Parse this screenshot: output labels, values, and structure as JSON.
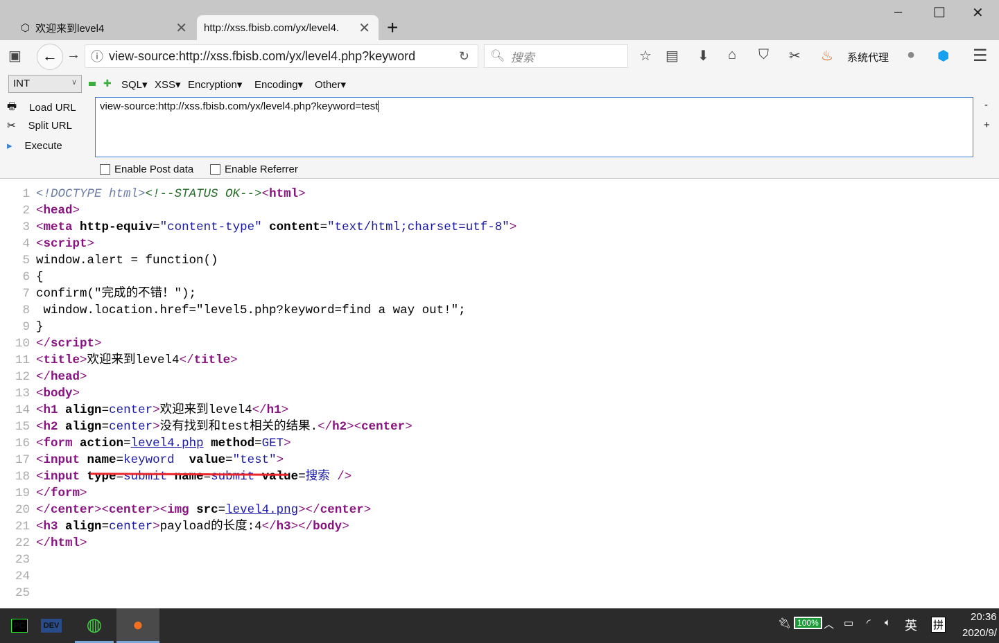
{
  "browser": {
    "tabs": [
      {
        "label": "欢迎来到level4",
        "active": false
      },
      {
        "label": "http://xss.fbisb.com/yx/level4.",
        "active": true
      }
    ],
    "new_tab": "+",
    "window_controls": {
      "minimize": "–",
      "maximize": "☐",
      "close": "✕"
    },
    "address": "view-source:http://xss.fbisb.com/yx/level4.php?keyword",
    "search_placeholder": "搜索",
    "proxy_label": "系统代理"
  },
  "hackbar": {
    "select_value": "INT",
    "menus": [
      "SQL▾",
      "XSS▾",
      "Encryption▾",
      "Encoding▾",
      "Other▾"
    ],
    "load_url": "Load URL",
    "split_url": "Split URL",
    "execute": "Execute",
    "url_value": "view-source:http://xss.fbisb.com/yx/level4.php?keyword=test",
    "minus": "-",
    "plus": "+",
    "enable_post": "Enable Post data",
    "enable_referrer": "Enable Referrer"
  },
  "source": {
    "lines": [
      [
        [
          "d",
          "<!DOCTYPE html>"
        ],
        [
          "c",
          "<!--STATUS OK-->"
        ],
        [
          "p",
          "<"
        ],
        [
          "t",
          "html"
        ],
        [
          "p",
          ">"
        ]
      ],
      [
        [
          "p",
          "<"
        ],
        [
          "t",
          "head"
        ],
        [
          "p",
          ">"
        ]
      ],
      [
        [
          "p",
          "<"
        ],
        [
          "t",
          "meta"
        ],
        [
          "x",
          " "
        ],
        [
          "a",
          "http-equiv"
        ],
        [
          "x",
          "="
        ],
        [
          "v",
          "\"content-type\""
        ],
        [
          "x",
          " "
        ],
        [
          "a",
          "content"
        ],
        [
          "x",
          "="
        ],
        [
          "v",
          "\"text/html;charset=utf-8\""
        ],
        [
          "p",
          ">"
        ]
      ],
      [
        [
          "p",
          "<"
        ],
        [
          "t",
          "script"
        ],
        [
          "p",
          ">"
        ]
      ],
      [
        [
          "x",
          "window.alert = function()"
        ]
      ],
      [
        [
          "x",
          "{"
        ]
      ],
      [
        [
          "x",
          "confirm(\"完成的不错！\");"
        ]
      ],
      [
        [
          "x",
          " window.location.href=\"level5.php?keyword=find a way out!\";"
        ]
      ],
      [
        [
          "x",
          "}"
        ]
      ],
      [
        [
          "p",
          "</"
        ],
        [
          "t",
          "script"
        ],
        [
          "p",
          ">"
        ]
      ],
      [
        [
          "p",
          "<"
        ],
        [
          "t",
          "title"
        ],
        [
          "p",
          ">"
        ],
        [
          "x",
          "欢迎来到level4"
        ],
        [
          "p",
          "</"
        ],
        [
          "t",
          "title"
        ],
        [
          "p",
          ">"
        ]
      ],
      [
        [
          "p",
          "</"
        ],
        [
          "t",
          "head"
        ],
        [
          "p",
          ">"
        ]
      ],
      [
        [
          "p",
          "<"
        ],
        [
          "t",
          "body"
        ],
        [
          "p",
          ">"
        ]
      ],
      [
        [
          "p",
          "<"
        ],
        [
          "t",
          "h1"
        ],
        [
          "x",
          " "
        ],
        [
          "a",
          "align"
        ],
        [
          "x",
          "="
        ],
        [
          "v",
          "center"
        ],
        [
          "p",
          ">"
        ],
        [
          "x",
          "欢迎来到level4"
        ],
        [
          "p",
          "</"
        ],
        [
          "t",
          "h1"
        ],
        [
          "p",
          ">"
        ]
      ],
      [
        [
          "p",
          "<"
        ],
        [
          "t",
          "h2"
        ],
        [
          "x",
          " "
        ],
        [
          "a",
          "align"
        ],
        [
          "x",
          "="
        ],
        [
          "v",
          "center"
        ],
        [
          "p",
          ">"
        ],
        [
          "x",
          "没有找到和test相关的结果."
        ],
        [
          "p",
          "</"
        ],
        [
          "t",
          "h2"
        ],
        [
          "p",
          "><"
        ],
        [
          "t",
          "center"
        ],
        [
          "p",
          ">"
        ]
      ],
      [
        [
          "p",
          "<"
        ],
        [
          "t",
          "form"
        ],
        [
          "x",
          " "
        ],
        [
          "a",
          "action"
        ],
        [
          "x",
          "="
        ],
        [
          "l",
          "level4.php"
        ],
        [
          "x",
          " "
        ],
        [
          "a",
          "method"
        ],
        [
          "x",
          "="
        ],
        [
          "v",
          "GET"
        ],
        [
          "p",
          ">"
        ]
      ],
      [
        [
          "p",
          "<"
        ],
        [
          "t",
          "input"
        ],
        [
          "x",
          " "
        ],
        [
          "a",
          "name"
        ],
        [
          "x",
          "="
        ],
        [
          "v",
          "keyword"
        ],
        [
          "x",
          "  "
        ],
        [
          "a",
          "value"
        ],
        [
          "x",
          "="
        ],
        [
          "v",
          "\"test\""
        ],
        [
          "p",
          ">"
        ]
      ],
      [
        [
          "p",
          "<"
        ],
        [
          "t",
          "input"
        ],
        [
          "x",
          " "
        ],
        [
          "a",
          "type"
        ],
        [
          "x",
          "="
        ],
        [
          "v",
          "submit"
        ],
        [
          "x",
          " "
        ],
        [
          "a",
          "name"
        ],
        [
          "x",
          "="
        ],
        [
          "v",
          "submit"
        ],
        [
          "x",
          " "
        ],
        [
          "a",
          "value"
        ],
        [
          "x",
          "="
        ],
        [
          "v",
          "搜索"
        ],
        [
          "x",
          " "
        ],
        [
          "p",
          "/>"
        ]
      ],
      [
        [
          "p",
          "</"
        ],
        [
          "t",
          "form"
        ],
        [
          "p",
          ">"
        ]
      ],
      [
        [
          "p",
          "</"
        ],
        [
          "t",
          "center"
        ],
        [
          "p",
          "><"
        ],
        [
          "t",
          "center"
        ],
        [
          "p",
          "><"
        ],
        [
          "t",
          "img"
        ],
        [
          "x",
          " "
        ],
        [
          "a",
          "src"
        ],
        [
          "x",
          "="
        ],
        [
          "l",
          "level4.png"
        ],
        [
          "p",
          "></"
        ],
        [
          "t",
          "center"
        ],
        [
          "p",
          ">"
        ]
      ],
      [
        [
          "p",
          "<"
        ],
        [
          "t",
          "h3"
        ],
        [
          "x",
          " "
        ],
        [
          "a",
          "align"
        ],
        [
          "x",
          "="
        ],
        [
          "v",
          "center"
        ],
        [
          "p",
          ">"
        ],
        [
          "x",
          "payload的长度:4"
        ],
        [
          "p",
          "</"
        ],
        [
          "t",
          "h3"
        ],
        [
          "p",
          "></"
        ],
        [
          "t",
          "body"
        ],
        [
          "p",
          ">"
        ]
      ],
      [
        [
          "p",
          "</"
        ],
        [
          "t",
          "html"
        ],
        [
          "p",
          ">"
        ]
      ],
      [],
      [],
      []
    ]
  },
  "taskbar": {
    "apps": [
      "PyCharm",
      "Dev-C++",
      "360 Browser",
      "Firefox"
    ],
    "battery": "100%",
    "ime": "英",
    "ime2": "拼",
    "time": "20:36",
    "date": "2020/9/"
  }
}
